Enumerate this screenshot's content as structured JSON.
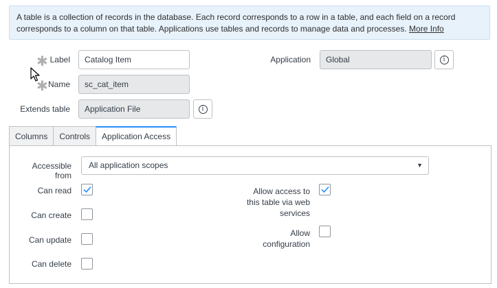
{
  "info": {
    "text": "A table is a collection of records in the database. Each record corresponds to a row in a table, and each field on a record corresponds to a column on that table. Applications use tables and records to manage data and processes. ",
    "link": "More Info"
  },
  "form": {
    "label": {
      "label": "Label",
      "value": "Catalog Item"
    },
    "name": {
      "label": "Name",
      "value": "sc_cat_item"
    },
    "extends": {
      "label": "Extends table",
      "value": "Application File"
    },
    "application": {
      "label": "Application",
      "value": "Global"
    }
  },
  "tabs": [
    {
      "label": "Columns",
      "active": false
    },
    {
      "label": "Controls",
      "active": false
    },
    {
      "label": "Application Access",
      "active": true
    }
  ],
  "access": {
    "accessible_from": {
      "label": "Accessible from",
      "value": "All application scopes"
    },
    "can_read": {
      "label": "Can read",
      "checked": true
    },
    "can_create": {
      "label": "Can create",
      "checked": false
    },
    "can_update": {
      "label": "Can update",
      "checked": false
    },
    "can_delete": {
      "label": "Can delete",
      "checked": false
    },
    "web_services": {
      "label_line1": "Allow access to",
      "label_line2": "this table via web",
      "label_line3": "services",
      "checked": true
    },
    "configuration": {
      "label_line1": "Allow",
      "label_line2": "configuration",
      "checked": false
    }
  },
  "colors": {
    "accent": "#278efc",
    "info_bg": "#e8f2fb"
  }
}
